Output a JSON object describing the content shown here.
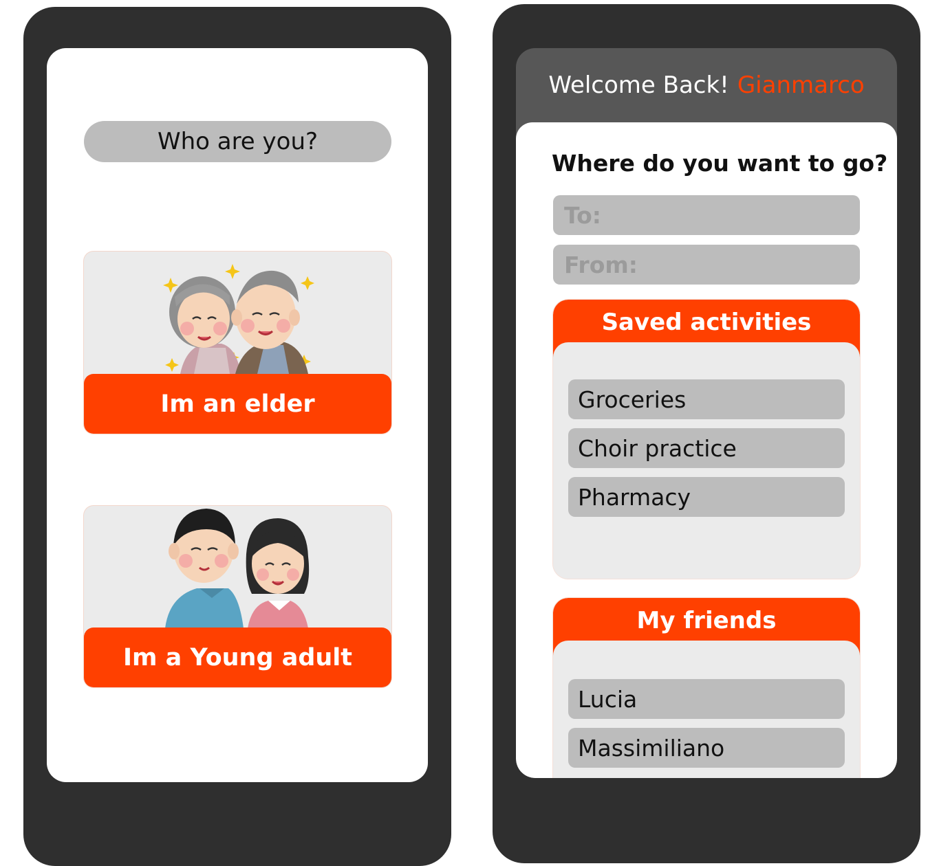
{
  "role_screen": {
    "title": "Who are you?",
    "roles": [
      {
        "label": "Im an elder",
        "illustration": "elderly-couple"
      },
      {
        "label": "Im a Young adult",
        "illustration": "young-couple"
      }
    ]
  },
  "home_screen": {
    "welcome_text": "Welcome Back!",
    "user_name": "Gianmarco",
    "question": "Where do you want to go?",
    "to_placeholder": "To:",
    "from_placeholder": "From:",
    "saved_activities": {
      "title": "Saved activities",
      "items": [
        "Groceries",
        "Choir practice",
        "Pharmacy"
      ]
    },
    "friends": {
      "title": "My friends",
      "items": [
        "Lucia",
        "Massimiliano"
      ]
    }
  },
  "colors": {
    "accent": "#ff4000",
    "phone_frame": "#2f2f2f",
    "header_bar": "#575757",
    "pill": "#bcbcbc",
    "card_bg": "#ebebeb"
  }
}
